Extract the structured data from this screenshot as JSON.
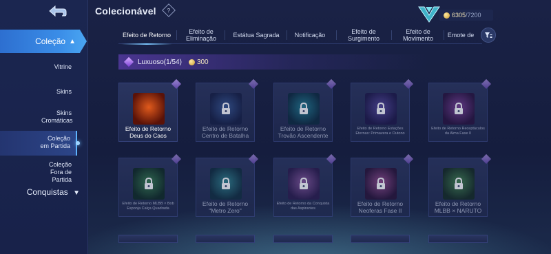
{
  "header": {
    "title": "Colecionável",
    "help_glyph": "?",
    "points_current": "6305",
    "points_max": "/7200"
  },
  "sidebar": {
    "active_section": "Coleção",
    "items": [
      {
        "label": "Vitrine"
      },
      {
        "label": "Skins"
      },
      {
        "label": "Skins Cromáticas"
      },
      {
        "label": "Coleção em Partida",
        "selected": true
      },
      {
        "label": "Coleção Fora de Partida"
      }
    ],
    "collapsed_section": "Conquistas"
  },
  "tabs": [
    {
      "label": "Efeito de Retorno",
      "active": true
    },
    {
      "label": "Efeito de Eliminação"
    },
    {
      "label": "Estátua Sagrada"
    },
    {
      "label": "Notificação"
    },
    {
      "label": "Efeito de Surgimento"
    },
    {
      "label": "Efeito de Movimento"
    },
    {
      "label": "Emote de"
    }
  ],
  "category": {
    "name": "Luxuoso(1/54)",
    "cost": "300"
  },
  "cards": [
    {
      "label": "Efeito de Retorno Deus do Caos",
      "locked": false,
      "small": false,
      "c1": "#e05a1c",
      "c2": "#5a1208"
    },
    {
      "label": "Efeito de Retorno Centro de Batalha",
      "locked": true,
      "small": false,
      "c1": "#4f79c9",
      "c2": "#1f2a5a"
    },
    {
      "label": "Efeito de Retorno Trovão Ascendente",
      "locked": true,
      "small": false,
      "c1": "#2fb0c9",
      "c2": "#123a52"
    },
    {
      "label": "Efeito de Retorno Estações Eternas: Primavera e Outono",
      "locked": true,
      "small": true,
      "c1": "#7a66d9",
      "c2": "#2a2060"
    },
    {
      "label": "Efeito de Retorno Receptáculos da Alma Fase II",
      "locked": true,
      "small": true,
      "c1": "#b05ad0",
      "c2": "#3a1850"
    },
    {
      "label": "Efeito de Retorno MLBB × Bob Esponja Calça Quadrada",
      "locked": true,
      "small": true,
      "c1": "#4fb06a",
      "c2": "#153a2a"
    },
    {
      "label": "Efeito de Retorno \"Metro Zero\"",
      "locked": true,
      "small": false,
      "c1": "#46b9c4",
      "c2": "#173e52"
    },
    {
      "label": "Efeito de Retorno da Conquista das Aspirantes",
      "locked": true,
      "small": true,
      "c1": "#c07ad8",
      "c2": "#3e2466"
    },
    {
      "label": "Efeito de Retorno Neoferas Fase II",
      "locked": true,
      "small": false,
      "c1": "#d068c0",
      "c2": "#3a1848"
    },
    {
      "label": "Efeito de Retorno MLBB × NARUTO",
      "locked": true,
      "small": false,
      "c1": "#5fb86a",
      "c2": "#1d3a28"
    }
  ],
  "colors": {
    "accent": "#3b8ee8",
    "gold": "#f0e3b6",
    "background": "#151d3e"
  }
}
